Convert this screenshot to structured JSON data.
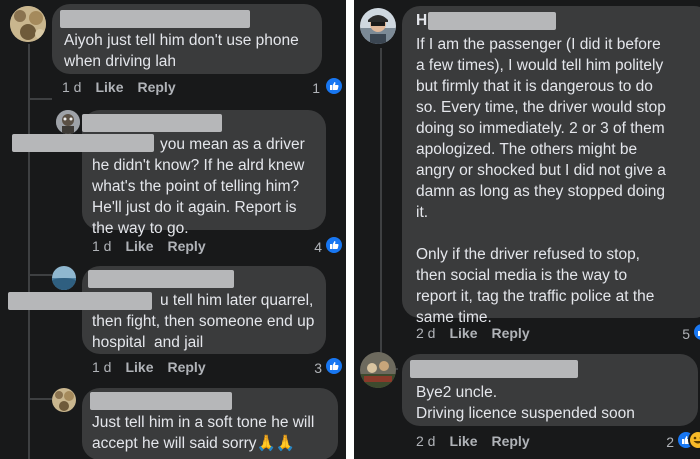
{
  "colors": {
    "background": "#18191a",
    "bubble": "#3a3b3c",
    "text": "#e4e6eb",
    "meta": "#b0b3b8",
    "like_blue": "#1877f2",
    "redaction": "#b6b7b9"
  },
  "left_thread": {
    "comments": [
      {
        "text": "Aiyoh just tell him don't use phone\nwhen driving lah",
        "time": "1 d",
        "like": "Like",
        "reply": "Reply",
        "reactions": "1",
        "reaction_icons": [
          "like-icon"
        ]
      },
      {
        "text": "you mean as a driver\nhe didn't know? If he alrd knew\nwhat's the point of telling him?\nHe'll just do it again. Report is\nthe way to go.",
        "time": "1 d",
        "like": "Like",
        "reply": "Reply",
        "reactions": "4",
        "reaction_icons": [
          "like-icon"
        ]
      },
      {
        "text": "u tell him later quarrel,\nthen fight, then someone end up\nhospital  and jail",
        "time": "1 d",
        "like": "Like",
        "reply": "Reply",
        "reactions": "3",
        "reaction_icons": [
          "like-icon"
        ]
      },
      {
        "text": "Just tell him in a soft tone he will\naccept he will said sorry🙏🙏",
        "reaction_icons": []
      }
    ]
  },
  "right_thread": {
    "comments": [
      {
        "author_initial": "H",
        "text": "If I am the passenger (I did it before\na few times), I would tell him politely\nbut firmly that it is dangerous to do\nso. Every time, the driver would stop\ndoing so immediately. 2 or 3 of them\napologized. The others might be\nangry or shocked but I did not give a\ndamn as long as they stopped doing\nit.\n\nOnly if the driver refused to stop,\nthen social media is the way to\nreport it, tag the traffic police at the\nsame time.",
        "time": "2 d",
        "like": "Like",
        "reply": "Reply",
        "reactions": "5",
        "reaction_icons": [
          "like-icon"
        ]
      },
      {
        "text": "Bye2 uncle.\nDriving licence suspended soon",
        "time": "2 d",
        "like": "Like",
        "reply": "Reply",
        "reactions": "2",
        "reaction_icons": [
          "like-icon",
          "laugh-icon"
        ]
      }
    ]
  }
}
